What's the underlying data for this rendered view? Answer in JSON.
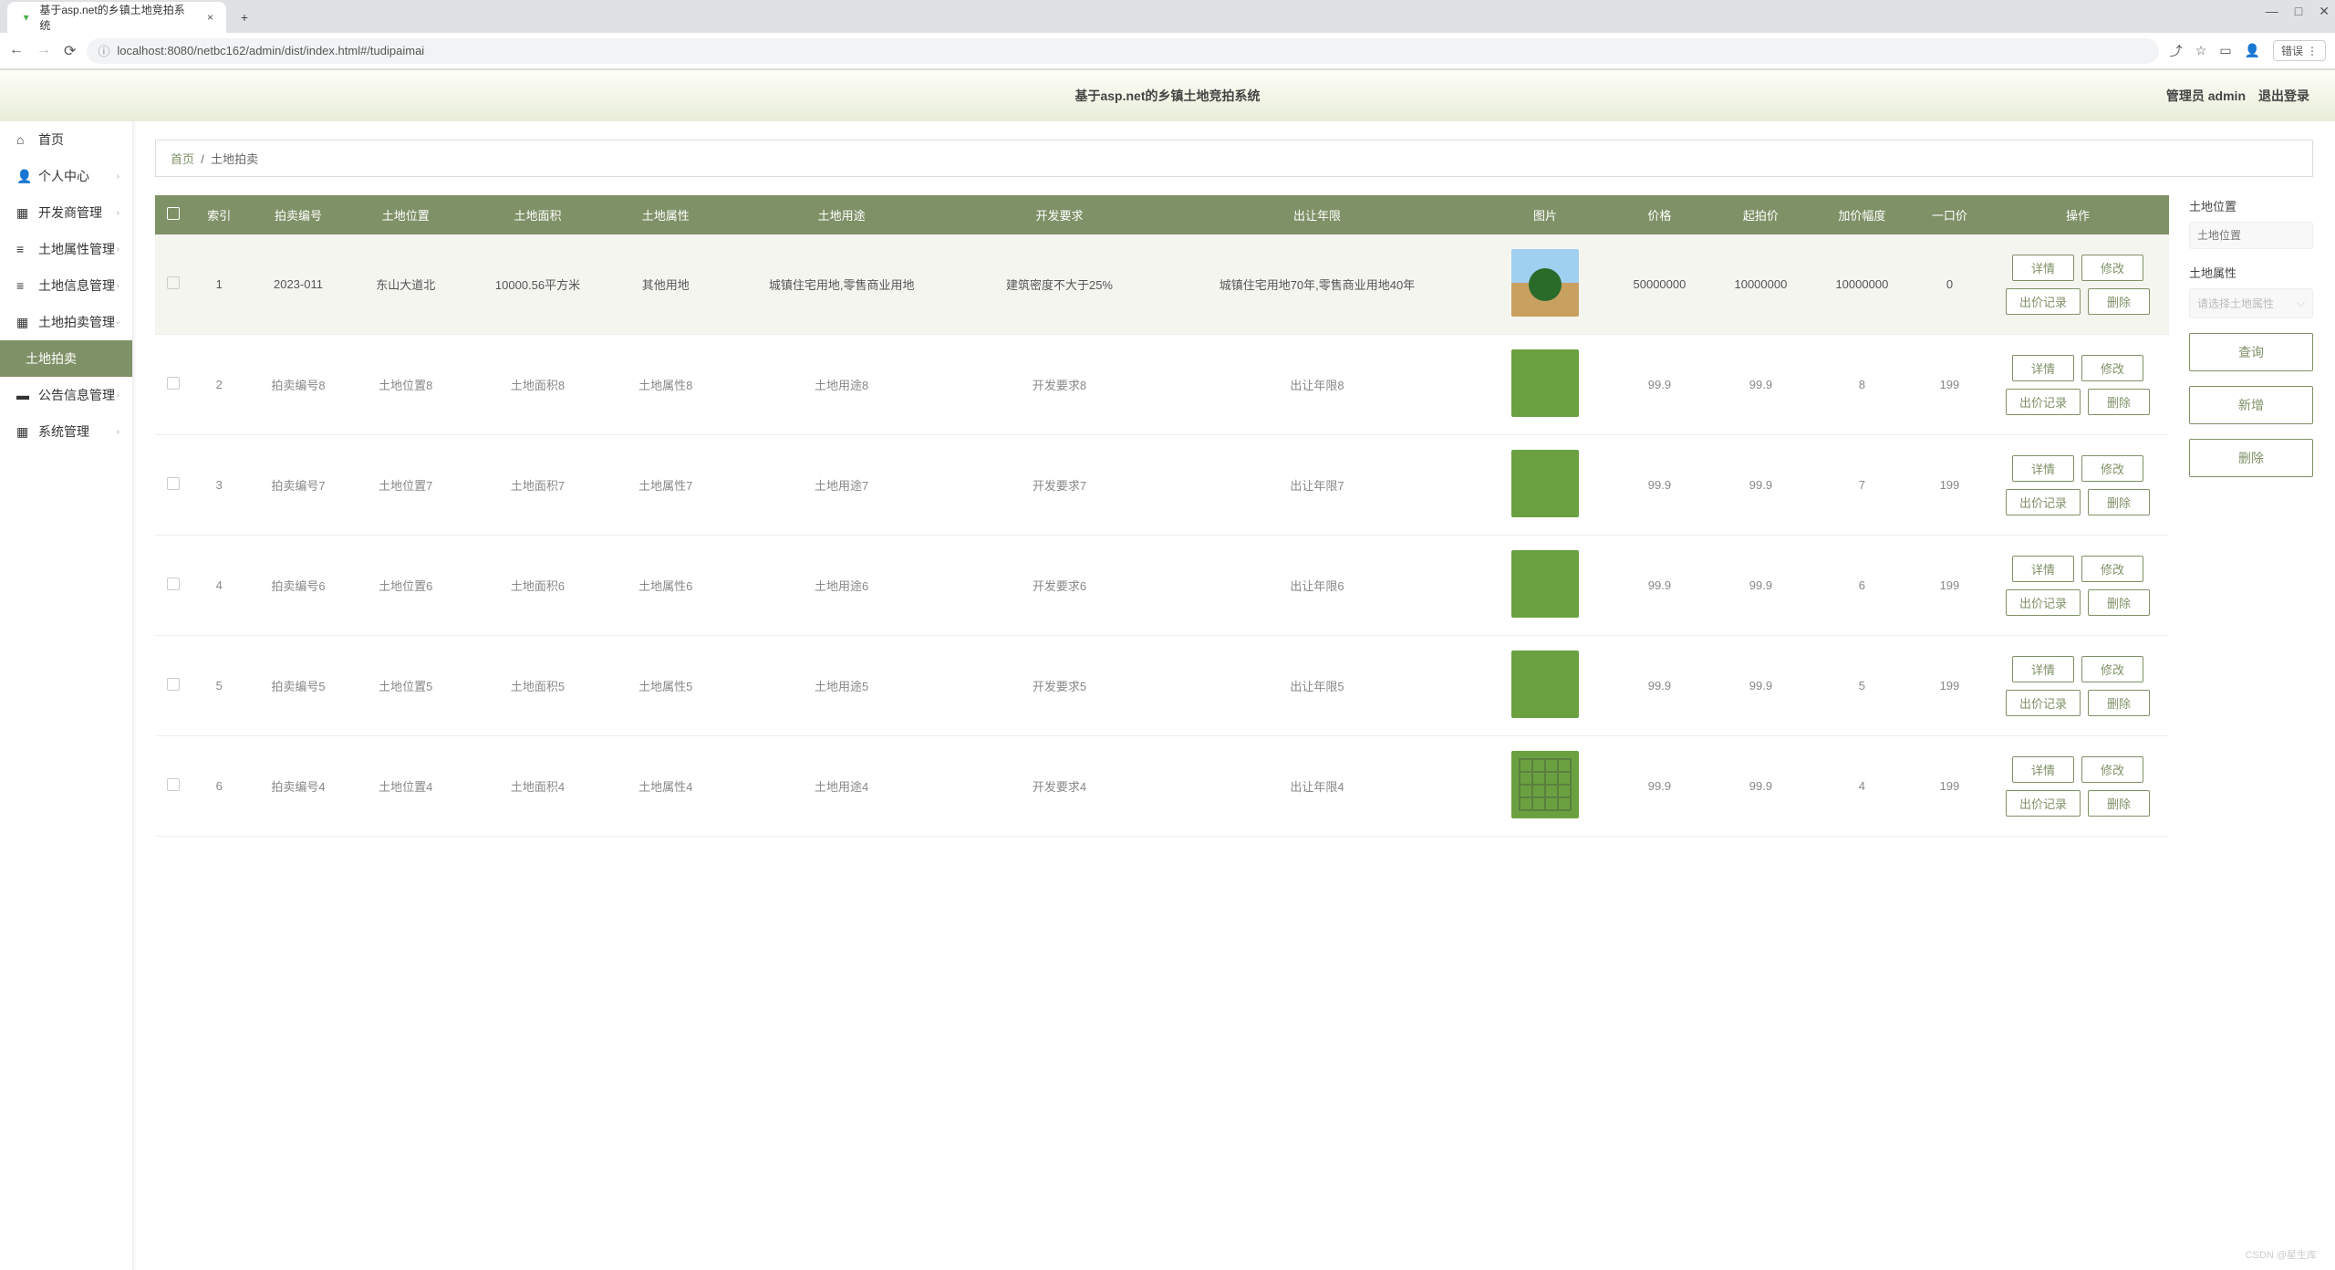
{
  "browser": {
    "tab_title": "基于asp.net的乡镇土地竞拍系统",
    "new_tab": "+",
    "close": "×",
    "back": "←",
    "fwd": "→",
    "reload": "⟳",
    "info": "ⓘ",
    "url": "localhost:8080/netbc162/admin/dist/index.html#/tudipaimai",
    "share": "⤴",
    "star": "☆",
    "install": "▭",
    "profile": "👤",
    "err": "错误",
    "more": "⋮",
    "min": "—",
    "max": "□",
    "closewin": "✕"
  },
  "header": {
    "title": "基于asp.net的乡镇土地竞拍系统",
    "user_label": "管理员 admin",
    "logout": "退出登录"
  },
  "sidebar": {
    "items": [
      {
        "icon": "⌂",
        "label": "首页",
        "caret": ""
      },
      {
        "icon": "👤",
        "label": "个人中心",
        "caret": "›"
      },
      {
        "icon": "▦",
        "label": "开发商管理",
        "caret": "›"
      },
      {
        "icon": "≡",
        "label": "土地属性管理",
        "caret": "›"
      },
      {
        "icon": "≡",
        "label": "土地信息管理",
        "caret": "›"
      },
      {
        "icon": "▦",
        "label": "土地拍卖管理",
        "caret": "›",
        "expanded": true
      },
      {
        "icon": "",
        "label": "土地拍卖",
        "caret": "",
        "active": true
      },
      {
        "icon": "▬",
        "label": "公告信息管理",
        "caret": "›"
      },
      {
        "icon": "▦",
        "label": "系统管理",
        "caret": "›"
      }
    ]
  },
  "breadcrumb": {
    "home": "首页",
    "sep": "/",
    "current": "土地拍卖"
  },
  "columns": [
    "",
    "索引",
    "拍卖编号",
    "土地位置",
    "土地面积",
    "土地属性",
    "土地用途",
    "开发要求",
    "出让年限",
    "图片",
    "价格",
    "起拍价",
    "加价幅度",
    "一口价",
    "操作"
  ],
  "rows": [
    {
      "idx": "1",
      "code": "2023-011",
      "loc": "东山大道北",
      "area": "10000.56平方米",
      "attr": "其他用地",
      "use": "城镇住宅用地,零售商业用地",
      "req": "建筑密度不大于25%",
      "term": "城镇住宅用地70年,零售商业用地40年",
      "img": "special",
      "price": "50000000",
      "start": "10000000",
      "step": "10000000",
      "one": "0"
    },
    {
      "idx": "2",
      "code": "拍卖编号8",
      "loc": "土地位置8",
      "area": "土地面积8",
      "attr": "土地属性8",
      "use": "土地用途8",
      "req": "开发要求8",
      "term": "出让年限8",
      "img": "field",
      "price": "99.9",
      "start": "99.9",
      "step": "8",
      "one": "199"
    },
    {
      "idx": "3",
      "code": "拍卖编号7",
      "loc": "土地位置7",
      "area": "土地面积7",
      "attr": "土地属性7",
      "use": "土地用途7",
      "req": "开发要求7",
      "term": "出让年限7",
      "img": "field",
      "price": "99.9",
      "start": "99.9",
      "step": "7",
      "one": "199"
    },
    {
      "idx": "4",
      "code": "拍卖编号6",
      "loc": "土地位置6",
      "area": "土地面积6",
      "attr": "土地属性6",
      "use": "土地用途6",
      "req": "开发要求6",
      "term": "出让年限6",
      "img": "field",
      "price": "99.9",
      "start": "99.9",
      "step": "6",
      "one": "199"
    },
    {
      "idx": "5",
      "code": "拍卖编号5",
      "loc": "土地位置5",
      "area": "土地面积5",
      "attr": "土地属性5",
      "use": "土地用途5",
      "req": "开发要求5",
      "term": "出让年限5",
      "img": "field",
      "price": "99.9",
      "start": "99.9",
      "step": "5",
      "one": "199"
    },
    {
      "idx": "6",
      "code": "拍卖编号4",
      "loc": "土地位置4",
      "area": "土地面积4",
      "attr": "土地属性4",
      "use": "土地用途4",
      "req": "开发要求4",
      "term": "出让年限4",
      "img": "grid",
      "price": "99.9",
      "start": "99.9",
      "step": "4",
      "one": "199"
    }
  ],
  "ops": {
    "detail": "详情",
    "edit": "修改",
    "bidlog": "出价记录",
    "del": "删除"
  },
  "filter": {
    "loc_label": "土地位置",
    "loc_ph": "土地位置",
    "attr_label": "土地属性",
    "attr_ph": "请选择土地属性",
    "query": "查询",
    "add": "新增",
    "delete": "删除"
  },
  "watermark": "CSDN @星生库"
}
